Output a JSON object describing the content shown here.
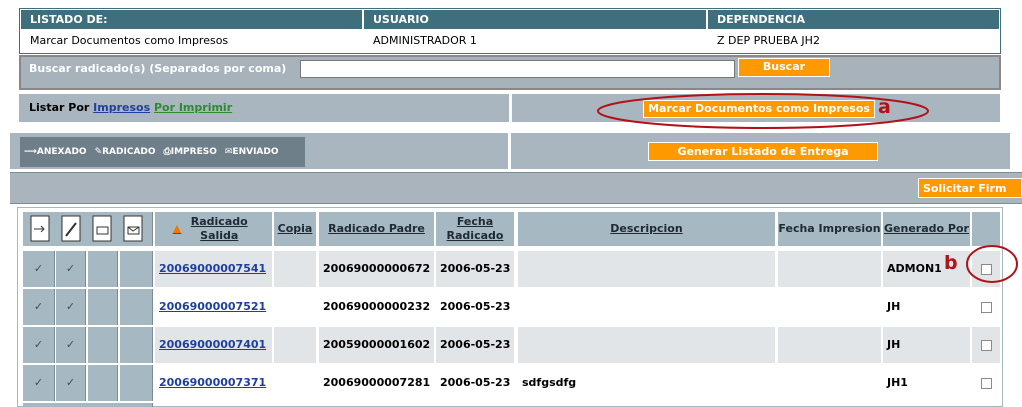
{
  "header": {
    "cols": [
      "LISTADO DE:",
      "USUARIO",
      "DEPENDENCIA"
    ],
    "values": [
      "Marcar Documentos como Impresos",
      "ADMINISTRADOR 1",
      "Z DEP PRUEBA JH2"
    ]
  },
  "search": {
    "label": "Buscar radicado(s) (Separados por coma)",
    "value": "",
    "button": "Buscar"
  },
  "list": {
    "label": "Listar Por",
    "link1": "Impresos",
    "link2": "Por Imprimir"
  },
  "actions": {
    "marcar": "Marcar Documentos como Impresos",
    "generar": "Generar Listado de Entrega",
    "solicitar": "Solicitar Firm",
    "toolbar": [
      "ANEXADO",
      "RADICADO",
      "IMPRESO",
      "ENVIADO"
    ]
  },
  "annotations": {
    "a": "a",
    "b": "b"
  },
  "table": {
    "headers": {
      "radicado": "Radicado Salida",
      "copia": "Copia",
      "padre": "Radicado Padre",
      "fecha": "Fecha Radicado",
      "descripcion": "Descripcion",
      "fechaimp": "Fecha Impresion",
      "generado": "Generado Por"
    },
    "rows": [
      {
        "radicado": "20069000007541",
        "copia": "",
        "padre": "20069000000672",
        "fecha": "2006-05-23",
        "descripcion": "",
        "fechaimp": "",
        "generado": "ADMON1"
      },
      {
        "radicado": "20069000007521",
        "copia": "",
        "padre": "20069000000232",
        "fecha": "2006-05-23",
        "descripcion": "",
        "fechaimp": "",
        "generado": "JH"
      },
      {
        "radicado": "20069000007401",
        "copia": "",
        "padre": "20059000001602",
        "fecha": "2006-05-23",
        "descripcion": "",
        "fechaimp": "",
        "generado": "JH"
      },
      {
        "radicado": "20069000007371",
        "copia": "",
        "padre": "20069000007281",
        "fecha": "2006-05-23",
        "descripcion": "sdfgsdfg",
        "fechaimp": "",
        "generado": "JH1"
      }
    ]
  },
  "colors": {
    "header": "#3f6f7c",
    "orange": "#ff9900",
    "annotation": "#b01218"
  }
}
